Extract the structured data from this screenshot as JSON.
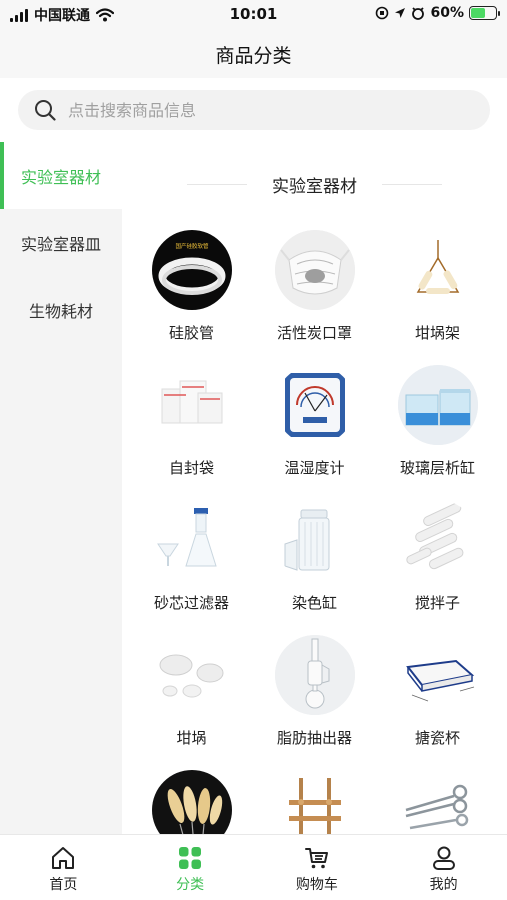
{
  "status": {
    "carrier": "中国联通",
    "time": "10:01",
    "battery": "60%",
    "battery_level": 0.6
  },
  "header": {
    "title": "商品分类"
  },
  "search": {
    "placeholder": "点击搜索商品信息"
  },
  "sidebar": {
    "items": [
      {
        "label": "实验室器材",
        "active": true
      },
      {
        "label": "实验室器皿",
        "active": false
      },
      {
        "label": "生物耗材",
        "active": false
      }
    ]
  },
  "main": {
    "section_title": "实验室器材",
    "products": [
      {
        "name": "硅胶管",
        "icon": "silicone-tube-image",
        "label_text": "国产硅胶软管"
      },
      {
        "name": "活性炭口罩",
        "icon": "carbon-mask-image"
      },
      {
        "name": "坩埚架",
        "icon": "crucible-rack-image"
      },
      {
        "name": "自封袋",
        "icon": "ziplock-bag-image"
      },
      {
        "name": "温湿度计",
        "icon": "hygrometer-image"
      },
      {
        "name": "玻璃层析缸",
        "icon": "chromatography-tank-image"
      },
      {
        "name": "砂芯过滤器",
        "icon": "sand-core-filter-image"
      },
      {
        "name": "染色缸",
        "icon": "staining-jar-image"
      },
      {
        "name": "搅拌子",
        "icon": "stir-bar-image"
      },
      {
        "name": "坩埚",
        "icon": "crucible-image"
      },
      {
        "name": "脂肪抽出器",
        "icon": "fat-extractor-image"
      },
      {
        "name": "搪瓷杯",
        "icon": "enamel-tray-image"
      },
      {
        "name": "",
        "icon": "brushes-image"
      },
      {
        "name": "",
        "icon": "stand-image"
      },
      {
        "name": "",
        "icon": "scissors-image"
      }
    ]
  },
  "colors": {
    "accent": "#3fbf55",
    "sidebar_bg": "#f4f4f4"
  },
  "tabbar": {
    "items": [
      {
        "label": "首页",
        "icon": "home-icon",
        "active": false
      },
      {
        "label": "分类",
        "icon": "category-icon",
        "active": true
      },
      {
        "label": "购物车",
        "icon": "cart-icon",
        "active": false
      },
      {
        "label": "我的",
        "icon": "user-icon",
        "active": false
      }
    ]
  }
}
